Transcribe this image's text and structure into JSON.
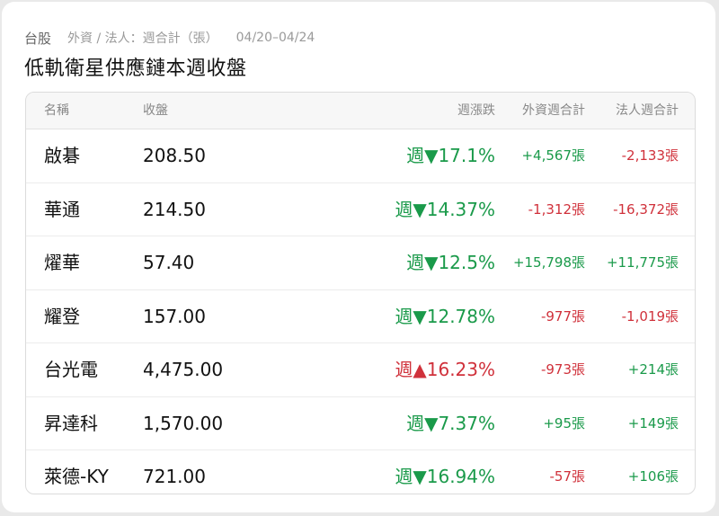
{
  "header": {
    "market": "台股",
    "subtitle": "外資 / 法人：週合計（張）",
    "date_range": "04/20–04/24",
    "title": "低軌衛星供應鏈本週收盤"
  },
  "table": {
    "columns": [
      "名稱",
      "收盤",
      "週漲跌",
      "外資週合計",
      "法人週合計"
    ],
    "rows": [
      {
        "name": "啟碁",
        "close": "208.50",
        "change": "週▼17.1%",
        "change_color": "green",
        "foreign": "+4,567張",
        "foreign_color": "green",
        "inst": "-2,133張",
        "inst_color": "red"
      },
      {
        "name": "華通",
        "close": "214.50",
        "change": "週▼14.37%",
        "change_color": "green",
        "foreign": "-1,312張",
        "foreign_color": "red",
        "inst": "-16,372張",
        "inst_color": "red"
      },
      {
        "name": "燿華",
        "close": "57.40",
        "change": "週▼12.5%",
        "change_color": "green",
        "foreign": "+15,798張",
        "foreign_color": "green",
        "inst": "+11,775張",
        "inst_color": "green"
      },
      {
        "name": "耀登",
        "close": "157.00",
        "change": "週▼12.78%",
        "change_color": "green",
        "foreign": "-977張",
        "foreign_color": "red",
        "inst": "-1,019張",
        "inst_color": "red"
      },
      {
        "name": "台光電",
        "close": "4,475.00",
        "change": "週▲16.23%",
        "change_color": "red",
        "foreign": "-973張",
        "foreign_color": "red",
        "inst": "+214張",
        "inst_color": "green"
      },
      {
        "name": "昇達科",
        "close": "1,570.00",
        "change": "週▼7.37%",
        "change_color": "green",
        "foreign": "+95張",
        "foreign_color": "green",
        "inst": "+149張",
        "inst_color": "green"
      },
      {
        "name": "萊德-KY",
        "close": "721.00",
        "change": "週▼16.94%",
        "change_color": "green",
        "foreign": "-57張",
        "foreign_color": "red",
        "inst": "+106張",
        "inst_color": "green"
      }
    ]
  },
  "colors": {
    "up": "#d0313b",
    "down": "#1a9a4a"
  }
}
